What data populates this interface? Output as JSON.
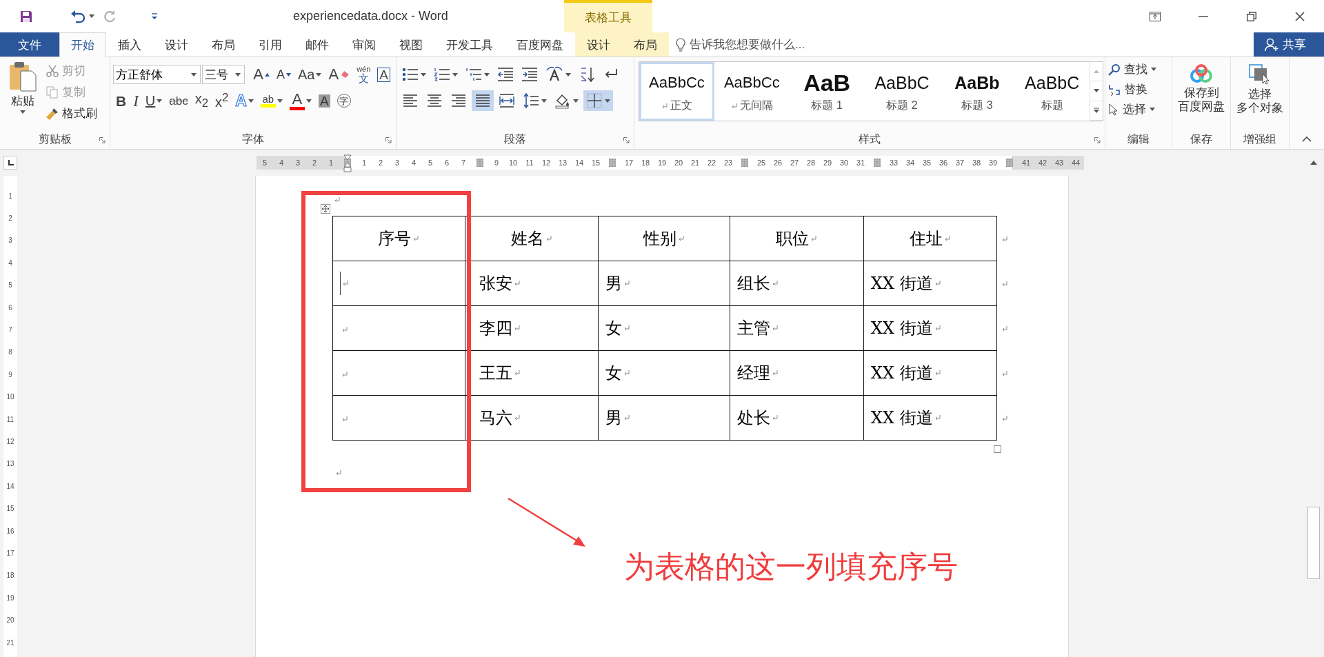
{
  "quick_access": [
    {
      "kind": "save",
      "disabled": false
    },
    {
      "kind": "undo",
      "disabled": false
    },
    {
      "kind": "redo",
      "disabled": true
    },
    {
      "kind": "customize",
      "disabled": false
    }
  ],
  "window": {
    "title": "experiencedata.docx - Word",
    "context_group": "表格工具"
  },
  "tabs": [
    {
      "label": "文件",
      "kind": "file",
      "selected": false
    },
    {
      "label": "开始",
      "kind": "normal",
      "selected": true
    },
    {
      "label": "插入",
      "kind": "normal",
      "selected": false
    },
    {
      "label": "设计",
      "kind": "normal",
      "selected": false
    },
    {
      "label": "布局",
      "kind": "normal",
      "selected": false
    },
    {
      "label": "引用",
      "kind": "normal",
      "selected": false
    },
    {
      "label": "邮件",
      "kind": "normal",
      "selected": false
    },
    {
      "label": "审阅",
      "kind": "normal",
      "selected": false
    },
    {
      "label": "视图",
      "kind": "normal",
      "selected": false
    },
    {
      "label": "开发工具",
      "kind": "normal",
      "selected": false
    },
    {
      "label": "百度网盘",
      "kind": "normal",
      "selected": false
    },
    {
      "label": "设计",
      "kind": "context",
      "selected": false
    },
    {
      "label": "布局",
      "kind": "context",
      "selected": false
    }
  ],
  "tell_me": {
    "placeholder": "告诉我您想要做什么..."
  },
  "share_button": "共享",
  "clipboard": {
    "label": "剪贴板",
    "paste": "粘贴",
    "items": [
      {
        "kind": "cut",
        "text": "剪切",
        "disabled": true
      },
      {
        "kind": "copy",
        "text": "复制",
        "disabled": true
      },
      {
        "kind": "painter",
        "text": "格式刷",
        "disabled": false
      }
    ]
  },
  "font": {
    "label": "字体",
    "font_name": "方正舒体",
    "font_size": "三号",
    "row1": [
      {
        "kind": "grow",
        "text": "A"
      },
      {
        "kind": "shrink",
        "text": "A"
      },
      {
        "kind": "case",
        "text": "Aa"
      },
      {
        "kind": "clear",
        "text": "A"
      },
      {
        "kind": "phonetic",
        "text": "wén",
        "sub": "文"
      },
      {
        "kind": "border",
        "text": "A"
      }
    ],
    "row2": [
      {
        "kind": "bold",
        "text": "B"
      },
      {
        "kind": "italic",
        "text": "I"
      },
      {
        "kind": "underline",
        "text": "U"
      },
      {
        "kind": "strike",
        "text": "abc"
      },
      {
        "kind": "script",
        "text": "x$_{2}$"
      },
      {
        "kind": "script",
        "text": "x$^{2}$"
      },
      {
        "kind": "effect",
        "text": "A"
      },
      {
        "kind": "highlight",
        "text": "ab",
        "color": "#ffff00"
      },
      {
        "kind": "color",
        "text": "A",
        "color": "#ff0000"
      },
      {
        "kind": "shade",
        "text": "A"
      },
      {
        "kind": "enclose",
        "text": "字"
      }
    ]
  },
  "paragraph": {
    "label": "段落",
    "row1": [
      {
        "kind": "bullets",
        "dropdown": true,
        "selected": false
      },
      {
        "kind": "numbering",
        "dropdown": true,
        "selected": false
      },
      {
        "kind": "multilevel",
        "dropdown": true,
        "selected": false
      },
      {
        "kind": "outdent",
        "dropdown": false,
        "selected": false
      },
      {
        "kind": "indent",
        "dropdown": false,
        "selected": false
      },
      {
        "kind": "spacing",
        "dropdown": true,
        "selected": false
      },
      {
        "kind": "sort",
        "dropdown": false,
        "selected": false
      },
      {
        "kind": "marks",
        "dropdown": false,
        "selected": false
      }
    ],
    "row2": [
      {
        "kind": "left",
        "dropdown": false,
        "selected": false
      },
      {
        "kind": "center",
        "dropdown": false,
        "selected": false
      },
      {
        "kind": "right",
        "dropdown": false,
        "selected": false
      },
      {
        "kind": "justify",
        "dropdown": false,
        "selected": true
      },
      {
        "kind": "distribute",
        "dropdown": false,
        "selected": false
      },
      {
        "kind": "linespacing",
        "dropdown": true,
        "selected": false
      },
      {
        "kind": "shading",
        "dropdown": true,
        "selected": false
      },
      {
        "kind": "borders",
        "dropdown": true,
        "selected": true
      }
    ]
  },
  "styles": {
    "label": "样式",
    "items": [
      {
        "kind": "normal",
        "preview": "AaBbCc",
        "label": "正文",
        "mark": true,
        "selected": true
      },
      {
        "kind": "normal",
        "preview": "AaBbCc",
        "label": "无间隔",
        "mark": true,
        "selected": false
      },
      {
        "kind": "heading1",
        "preview": "AaB",
        "label": "标题 1",
        "mark": false,
        "selected": false
      },
      {
        "kind": "heading2",
        "preview": "AaBbC",
        "label": "标题 2",
        "mark": false,
        "selected": false
      },
      {
        "kind": "heading3",
        "preview": "AaBb",
        "label": "标题 3",
        "mark": false,
        "selected": false
      },
      {
        "kind": "title",
        "preview": "AaBbC",
        "label": "标题",
        "mark": false,
        "selected": false
      }
    ]
  },
  "editing": {
    "label": "编辑",
    "items": [
      {
        "kind": "find",
        "text": "查找",
        "dropdown": true
      },
      {
        "kind": "replace",
        "text": "替换",
        "dropdown": false
      },
      {
        "kind": "select",
        "text": "选择",
        "dropdown": true
      }
    ]
  },
  "save_group": {
    "label": "保存",
    "lines": [
      "保存到",
      "百度网盘"
    ]
  },
  "enhance_group": {
    "label": "增强组",
    "lines": [
      "选择",
      "多个对象"
    ]
  },
  "ruler": {
    "marks": [
      {
        "kind": "number",
        "text": "5"
      },
      {
        "kind": "number",
        "text": "4"
      },
      {
        "kind": "number",
        "text": "3"
      },
      {
        "kind": "number",
        "text": "2"
      },
      {
        "kind": "number",
        "text": "1"
      },
      {
        "kind": "marker"
      },
      {
        "kind": "number",
        "text": "1"
      },
      {
        "kind": "number",
        "text": "2"
      },
      {
        "kind": "number",
        "text": "3"
      },
      {
        "kind": "number",
        "text": "4"
      },
      {
        "kind": "number",
        "text": "5"
      },
      {
        "kind": "number",
        "text": "6"
      },
      {
        "kind": "number",
        "text": "7"
      },
      {
        "kind": "marker"
      },
      {
        "kind": "number",
        "text": "9"
      },
      {
        "kind": "number",
        "text": "10"
      },
      {
        "kind": "number",
        "text": "11"
      },
      {
        "kind": "number",
        "text": "12"
      },
      {
        "kind": "number",
        "text": "13"
      },
      {
        "kind": "number",
        "text": "14"
      },
      {
        "kind": "number",
        "text": "15"
      },
      {
        "kind": "marker"
      },
      {
        "kind": "number",
        "text": "17"
      },
      {
        "kind": "number",
        "text": "18"
      },
      {
        "kind": "number",
        "text": "19"
      },
      {
        "kind": "number",
        "text": "20"
      },
      {
        "kind": "number",
        "text": "21"
      },
      {
        "kind": "number",
        "text": "22"
      },
      {
        "kind": "number",
        "text": "23"
      },
      {
        "kind": "marker"
      },
      {
        "kind": "number",
        "text": "25"
      },
      {
        "kind": "number",
        "text": "26"
      },
      {
        "kind": "number",
        "text": "27"
      },
      {
        "kind": "number",
        "text": "28"
      },
      {
        "kind": "number",
        "text": "29"
      },
      {
        "kind": "number",
        "text": "30"
      },
      {
        "kind": "number",
        "text": "31"
      },
      {
        "kind": "marker"
      },
      {
        "kind": "number",
        "text": "33"
      },
      {
        "kind": "number",
        "text": "34"
      },
      {
        "kind": "number",
        "text": "35"
      },
      {
        "kind": "number",
        "text": "36"
      },
      {
        "kind": "number",
        "text": "37"
      },
      {
        "kind": "number",
        "text": "38"
      },
      {
        "kind": "number",
        "text": "39"
      },
      {
        "kind": "marker"
      },
      {
        "kind": "number",
        "text": "41"
      },
      {
        "kind": "number",
        "text": "42"
      },
      {
        "kind": "number",
        "text": "43"
      },
      {
        "kind": "number",
        "text": "44"
      }
    ],
    "vertical": [
      "1",
      "2",
      "3",
      "4",
      "5",
      "6",
      "7",
      "8",
      "9",
      "10",
      "11",
      "12",
      "13",
      "14",
      "15",
      "16",
      "17",
      "18",
      "19",
      "20",
      "21"
    ]
  },
  "table": {
    "columns": [
      "序号",
      "姓名",
      "性别",
      "职位",
      "住址"
    ],
    "rows": [
      {
        "caret": true,
        "name": "张安",
        "gender": "男",
        "position": "组长",
        "address": "XX 街道"
      },
      {
        "caret": false,
        "name": "李四",
        "gender": "女",
        "position": "主管",
        "address": "XX 街道"
      },
      {
        "caret": false,
        "name": "王五",
        "gender": "女",
        "position": "经理",
        "address": "XX 街道"
      },
      {
        "caret": false,
        "name": "马六",
        "gender": "男",
        "position": "处长",
        "address": "XX 街道"
      }
    ]
  },
  "annotation": {
    "caption": "为表格的这一列填充序号"
  }
}
